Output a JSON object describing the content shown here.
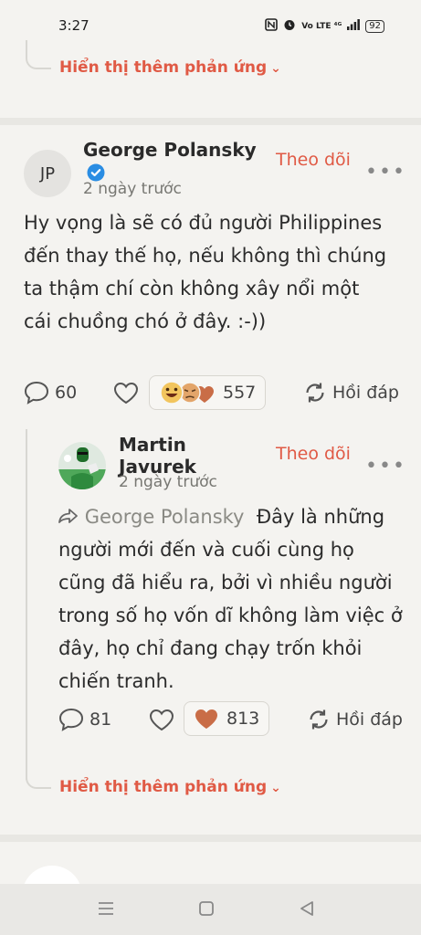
{
  "status_bar": {
    "time": "3:27",
    "network": "Vo LTE ⁴ᴳ",
    "battery": "92"
  },
  "colors": {
    "accent": "#e05a45",
    "verified": "#2a8de3",
    "background": "#f4f3f0"
  },
  "top_thread": {
    "more_reactions_label": "Hiển thị thêm phản ứng"
  },
  "comment1": {
    "avatar_initials": "JP",
    "author": "George Polansky",
    "verified_icon": "check-badge-icon",
    "time": "2 ngày trước",
    "follow_label": "Theo dõi",
    "more_label": "•••",
    "text": "Hy vọng là sẽ có đủ người Philippines đến thay thế họ, nếu không thì chúng ta thậm chí còn không xây nổi một cái chuồng chó ở đây. :-))",
    "comment_count": "60",
    "reaction_count": "557",
    "reply_label": "Hồi đáp"
  },
  "reply1": {
    "author": "Martin Javurek",
    "time": "2 ngày trước",
    "follow_label": "Theo dõi",
    "more_label": "•••",
    "reply_to": "George Polansky",
    "text": "Đây là những người mới đến và cuối cùng họ cũng đã hiểu ra, bởi vì nhiều người trong số họ vốn dĩ không làm việc ở đây, họ chỉ đang chạy trốn khỏi chiến tranh.",
    "comment_count": "81",
    "reaction_count": "813",
    "reply_label": "Hồi đáp"
  },
  "bottom_thread": {
    "more_reactions_label": "Hiển thị thêm phản ứng"
  },
  "nav_bar": {
    "menu_icon": "menu-icon",
    "home_icon": "home-square-icon",
    "back_icon": "back-triangle-icon"
  }
}
